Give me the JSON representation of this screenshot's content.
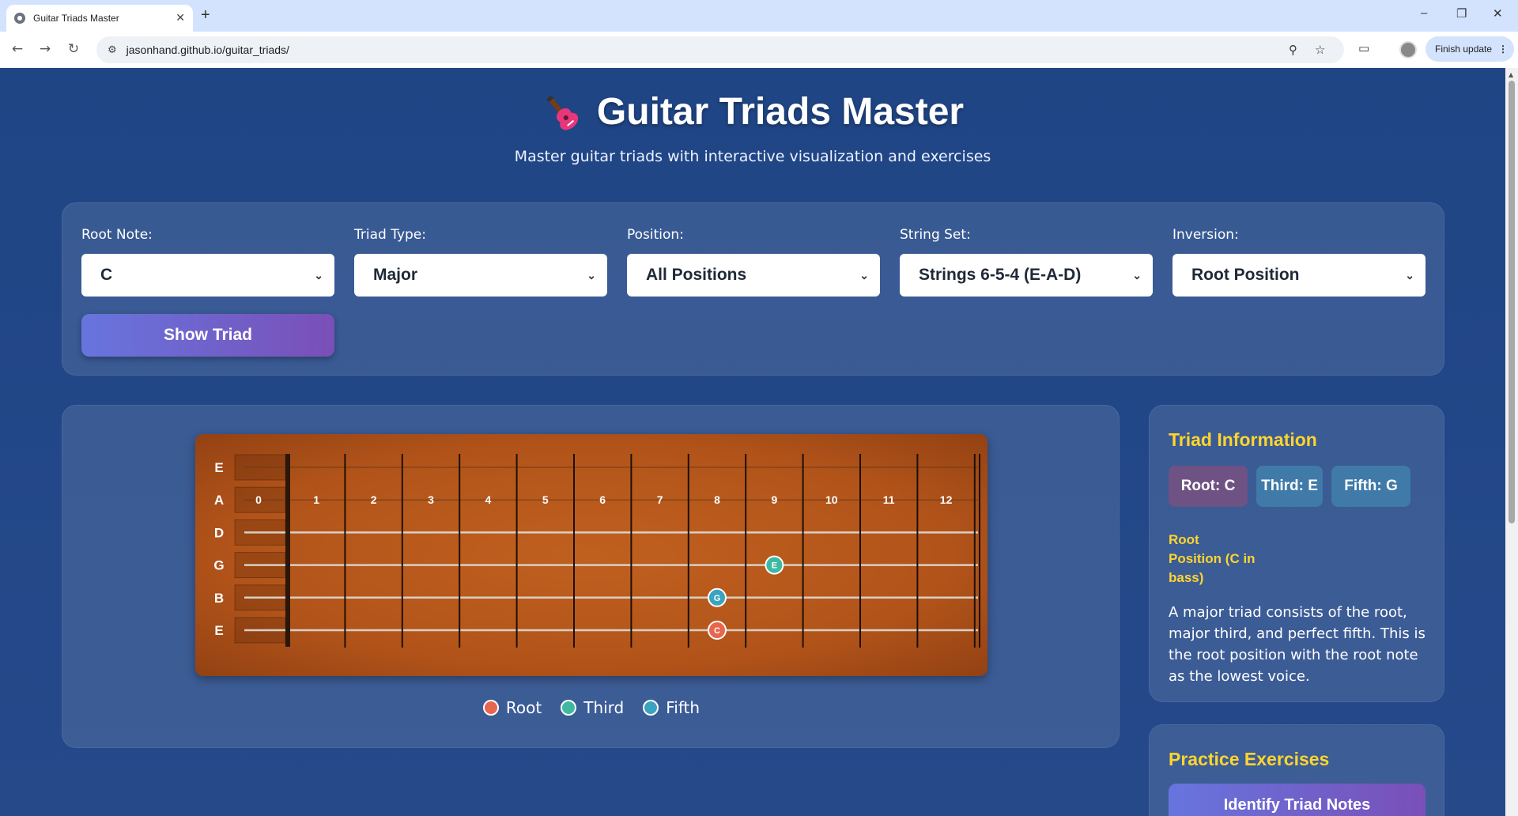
{
  "browser": {
    "tab_title": "Guitar Triads Master",
    "url": "jasonhand.github.io/guitar_triads/",
    "finish_update": "Finish update"
  },
  "header": {
    "title": "Guitar Triads Master",
    "subtitle": "Master guitar triads with interactive visualization and exercises"
  },
  "controls": {
    "root_note": {
      "label": "Root Note:",
      "value": "C"
    },
    "triad_type": {
      "label": "Triad Type:",
      "value": "Major"
    },
    "position": {
      "label": "Position:",
      "value": "All Positions"
    },
    "string_set": {
      "label": "String Set:",
      "value": "Strings 6-5-4 (E-A-D)"
    },
    "inversion": {
      "label": "Inversion:",
      "value": "Root Position"
    },
    "show_button": "Show Triad"
  },
  "fretboard": {
    "strings": [
      "E",
      "A",
      "D",
      "G",
      "B",
      "E"
    ],
    "fret_numbers": [
      "0",
      "1",
      "2",
      "3",
      "4",
      "5",
      "6",
      "7",
      "8",
      "9",
      "10",
      "11",
      "12"
    ],
    "notes": [
      {
        "string": 3,
        "fret": 9,
        "label": "E",
        "role": "third"
      },
      {
        "string": 4,
        "fret": 8,
        "label": "G",
        "role": "fifth"
      },
      {
        "string": 5,
        "fret": 8,
        "label": "C",
        "role": "root"
      }
    ],
    "colors": {
      "root": "#e8664d",
      "third": "#3fb8a3",
      "fifth": "#3aa3c0",
      "wood": "#b9561b"
    }
  },
  "legend": [
    {
      "label": "Root",
      "color": "#e8664d"
    },
    {
      "label": "Third",
      "color": "#3fb8a3"
    },
    {
      "label": "Fifth",
      "color": "#3aa3c0"
    }
  ],
  "info": {
    "title": "Triad Information",
    "root": "Root: C",
    "third": "Third: E",
    "fifth": "Fifth: G",
    "position_label": "Root Position (C in bass)",
    "description": "A major triad consists of the root, major third, and perfect fifth. This is the root position with the root note as the lowest voice."
  },
  "practice": {
    "title": "Practice Exercises",
    "button": "Identify Triad Notes"
  }
}
